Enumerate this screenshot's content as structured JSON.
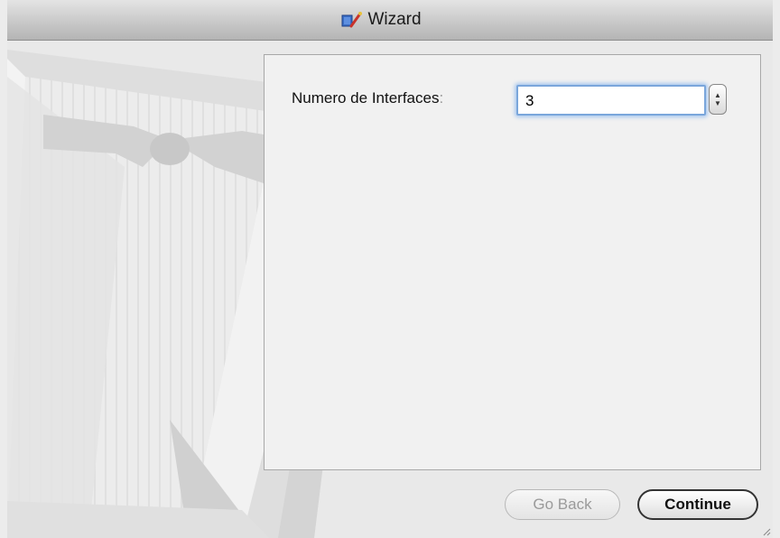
{
  "window": {
    "title": "Wizard",
    "title_icon": "wizard-app-icon"
  },
  "form": {
    "interfaces_label": "Numero de Interfaces",
    "interfaces_colon": ":",
    "interfaces_value": "3"
  },
  "buttons": {
    "back_label": "Go Back",
    "continue_label": "Continue"
  },
  "colors": {
    "focus_ring": "#7aa6db",
    "panel_bg": "#f1f1f1",
    "window_bg": "#e9e9e9"
  },
  "icons": {
    "stepper_up": "stepper-up-icon",
    "stepper_down": "stepper-down-icon",
    "background_art": "tuxedo-bowtie-image"
  }
}
